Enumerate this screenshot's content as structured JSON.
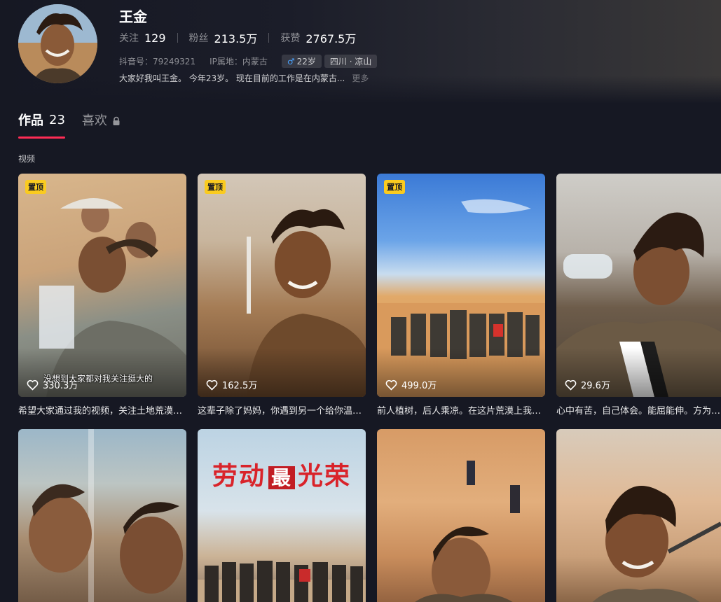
{
  "profile": {
    "name": "王金",
    "stats": [
      {
        "label": "关注",
        "value": "129"
      },
      {
        "label": "粉丝",
        "value": "213.5万"
      },
      {
        "label": "获赞",
        "value": "2767.5万"
      }
    ],
    "douyin_id": "抖音号：79249321",
    "ip_location": "IP属地：内蒙古",
    "gender_age": "22岁",
    "region": "四川 · 凉山",
    "bio": "大家好我叫王金。 今年23岁。 现在目前的工作是在内蒙古...",
    "bio_more": "更多"
  },
  "tabs": [
    {
      "label": "作品",
      "count": "23"
    },
    {
      "label": "喜欢"
    }
  ],
  "section_label": "视频",
  "videos": [
    {
      "pinned": "置顶",
      "likes": "330.3万",
      "overlay": "没想到大家都对我关注挺大的",
      "title": "希望大家通过我的视频，关注土地荒漠化问题"
    },
    {
      "pinned": "置顶",
      "likes": "162.5万",
      "title": "这辈子除了妈妈，你遇到另一个给你温暖的人"
    },
    {
      "pinned": "置顶",
      "likes": "499.0万",
      "title": "前人植树，后人乘凉。在这片荒漠上我们种下希望"
    },
    {
      "likes": "29.6万",
      "title": "心中有苦，自己体会。能屈能伸。方为大丈夫"
    },
    {
      "title": ""
    },
    {
      "banner_left": "劳动",
      "banner_mid": "最",
      "banner_right": "光荣",
      "title": ""
    },
    {
      "title": ""
    },
    {
      "title": ""
    }
  ],
  "colors": {
    "background": "#161823",
    "accent": "#fe2c55",
    "pin_badge": "#facb1f"
  }
}
